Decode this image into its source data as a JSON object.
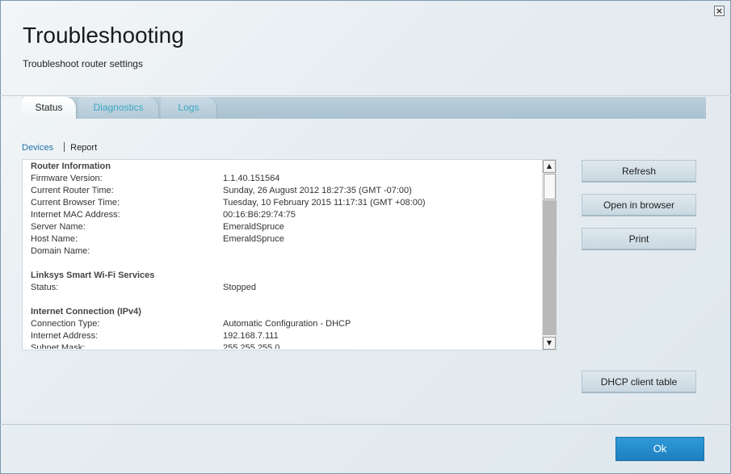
{
  "window": {
    "close_glyph": "×"
  },
  "header": {
    "title": "Troubleshooting",
    "subtitle": "Troubleshoot router settings"
  },
  "tabs": [
    {
      "label": "Status",
      "active": true
    },
    {
      "label": "Diagnostics",
      "active": false
    },
    {
      "label": "Logs",
      "active": false
    }
  ],
  "subnav": {
    "devices_link": "Devices",
    "report_label": "Report"
  },
  "report": {
    "sections": [
      {
        "title": "Router Information",
        "rows": [
          {
            "key": "Firmware Version:",
            "value": "1.1.40.151564"
          },
          {
            "key": "Current Router Time:",
            "value": "Sunday, 26 August 2012 18:27:35 (GMT -07:00)"
          },
          {
            "key": "Current Browser Time:",
            "value": "Tuesday, 10 February 2015 11:17:31 (GMT +08:00)"
          },
          {
            "key": "Internet MAC Address:",
            "value": "00:16:B6:29:74:75"
          },
          {
            "key": "Server Name:",
            "value": "EmeraldSpruce"
          },
          {
            "key": "Host Name:",
            "value": "EmeraldSpruce"
          },
          {
            "key": "Domain Name:",
            "value": ""
          }
        ]
      },
      {
        "title": "Linksys Smart Wi-Fi Services",
        "rows": [
          {
            "key": "Status:",
            "value": "Stopped"
          }
        ]
      },
      {
        "title": "Internet Connection (IPv4)",
        "rows": [
          {
            "key": "Connection Type:",
            "value": "Automatic Configuration - DHCP"
          },
          {
            "key": "Internet Address:",
            "value": "192.168.7.111"
          },
          {
            "key": "Subnet Mask:",
            "value": "255.255.255.0"
          }
        ]
      }
    ]
  },
  "scrollbar": {
    "up_glyph": "▲",
    "down_glyph": "▼"
  },
  "actions": {
    "refresh": "Refresh",
    "open_in_browser": "Open in browser",
    "print": "Print",
    "dhcp_client_table": "DHCP client table"
  },
  "footer": {
    "ok": "Ok"
  }
}
